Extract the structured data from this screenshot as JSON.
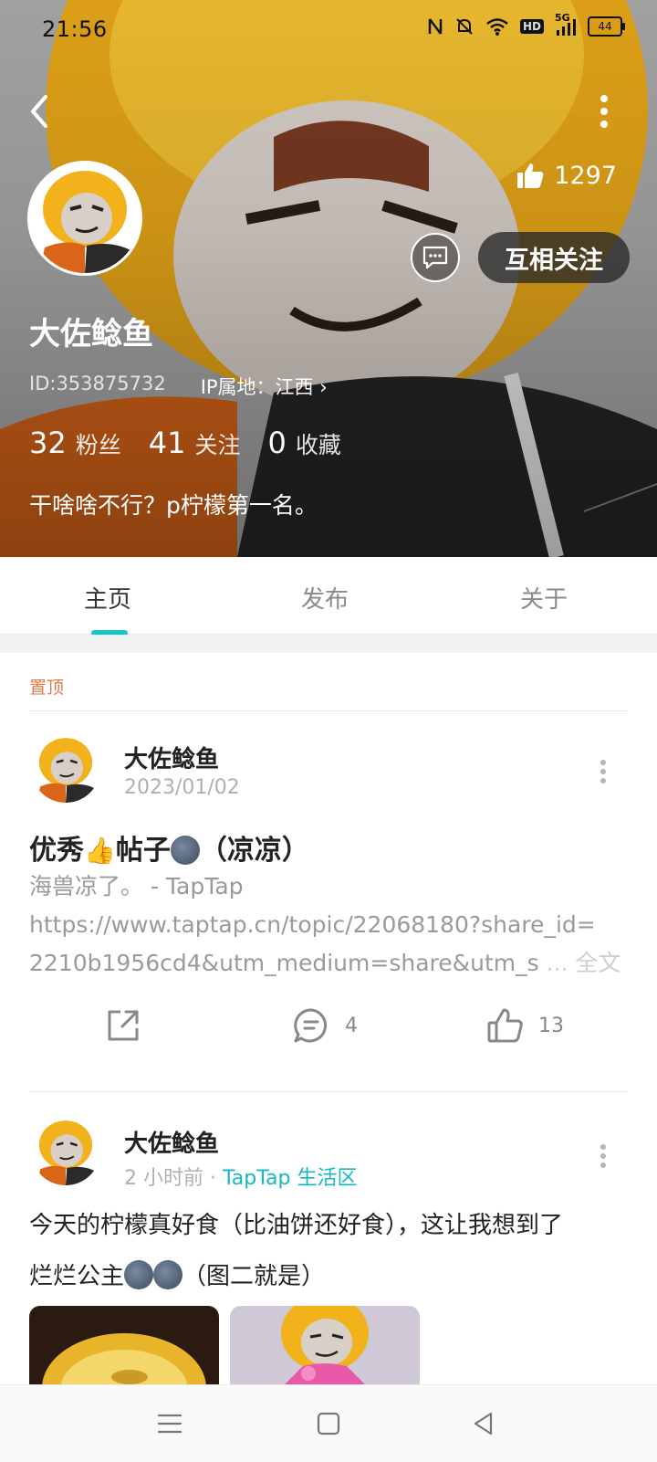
{
  "status_bar": {
    "time": "21:56",
    "battery": "44",
    "network": "5G",
    "hd": "HD"
  },
  "profile": {
    "likes": "1297",
    "follow_label": "互相关注",
    "nickname": "大佐鲶鱼",
    "id_text": "ID:353875732",
    "ip_text": "IP属地：江西 ›",
    "stats": [
      {
        "num": "32",
        "label": "粉丝"
      },
      {
        "num": "41",
        "label": "关注"
      },
      {
        "num": "0",
        "label": "收藏"
      }
    ],
    "bio": "干啥啥不行？p柠檬第一名。"
  },
  "tabs": [
    {
      "label": "主页"
    },
    {
      "label": "发布"
    },
    {
      "label": "关于"
    }
  ],
  "pinned_label": "置顶",
  "posts": [
    {
      "author": "大佐鲶鱼",
      "date": "2023/01/02",
      "title_a": "优秀",
      "title_b": "帖子",
      "title_c": "（凉凉）",
      "line1": "海兽凉了。 - TapTap",
      "line2": "https://www.taptap.cn/topic/22068180?share_id=",
      "line3": "2210b1956cd4&utm_medium=share&utm_s",
      "ellipsis": " ... ",
      "full_text": "全文",
      "comments": "4",
      "likes": "13"
    },
    {
      "author": "大佐鲶鱼",
      "time": "2 小时前",
      "sep": " · ",
      "zone": "TapTap 生活区",
      "line1": "今天的柠檬真好食（比油饼还好食），这让我想到了",
      "line2_a": "烂烂公主",
      "line2_b": "（图二就是）"
    }
  ],
  "colors": {
    "accent": "#15c5ce",
    "pinned": "#e07a4a",
    "zone": "#15b8c2"
  }
}
